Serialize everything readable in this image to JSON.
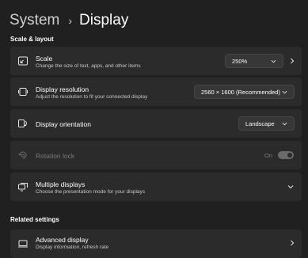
{
  "breadcrumb": {
    "parent": "System",
    "separator": "›",
    "current": "Display"
  },
  "sections": {
    "scale_layout": "Scale & layout",
    "related": "Related settings"
  },
  "scale": {
    "title": "Scale",
    "subtitle": "Change the size of text, apps, and other items",
    "value": "250%"
  },
  "resolution": {
    "title": "Display resolution",
    "subtitle": "Adjust the resolution to fit your connected display",
    "value": "2560 × 1600 (Recommended)"
  },
  "orientation": {
    "title": "Display orientation",
    "value": "Landscape"
  },
  "rotation_lock": {
    "title": "Rotation lock",
    "state": "On",
    "enabled": false
  },
  "multiple": {
    "title": "Multiple displays",
    "subtitle": "Choose the presentation mode for your displays"
  },
  "advanced": {
    "title": "Advanced display",
    "subtitle": "Display information, refresh rate"
  }
}
